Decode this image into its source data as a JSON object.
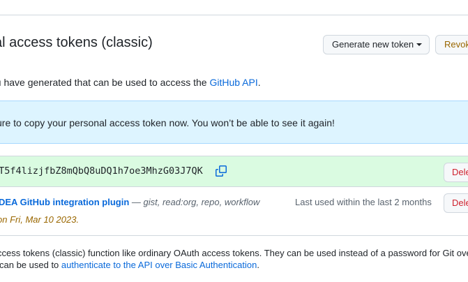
{
  "header": {
    "title": "al access tokens (classic)",
    "generate_button": "Generate new token",
    "revoke_button": "Revoke all"
  },
  "intro": {
    "text_before": "ou have generated that can be used to access the ",
    "link": "GitHub API",
    "text_after": "."
  },
  "flash": {
    "message": "sure to copy your personal access token now. You won’t be able to see it again!"
  },
  "new_token": {
    "value": "_T5f4lizjfbZ8mQbQ8uDQ1h7oe3MhzG03J7QK",
    "copy_icon": "copy-icon",
    "delete_button": "Delete"
  },
  "token": {
    "name": "DEA GitHub integration plugin",
    "scopes": " — gist, read:org, repo, workflow",
    "expiry": "on Fri, Mar 10 2023",
    "expiry_suffix": ".",
    "last_used": "Last used within the last 2 months",
    "delete_button": "Delete"
  },
  "footer": {
    "line1": "ccess tokens (classic) function like ordinary OAuth access tokens. They can be used instead of a password for Git over HTTPS, or",
    "line2_before": "can be used to ",
    "line2_link": "authenticate to the API over Basic Authentication",
    "line2_after": "."
  },
  "colors": {
    "link": "#0969da",
    "danger": "#cf222e",
    "warning": "#9a6700",
    "flash_bg": "#ddf4ff",
    "success_bg": "#dafbe1"
  }
}
